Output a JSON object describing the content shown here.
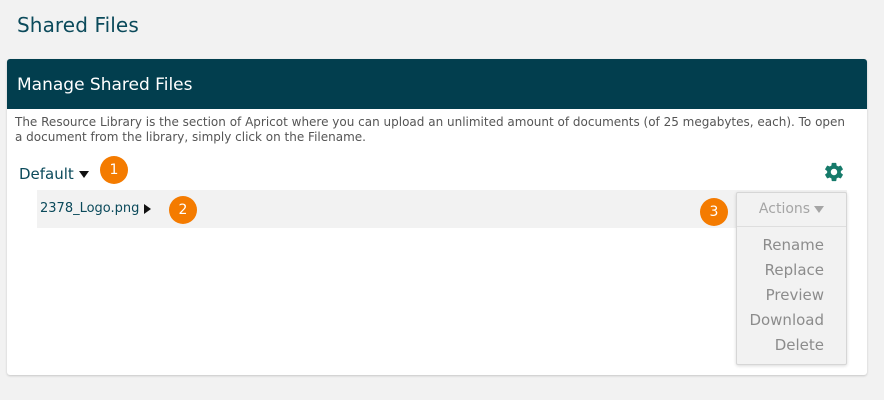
{
  "page": {
    "title": "Shared Files"
  },
  "panel": {
    "title": "Manage Shared Files",
    "description": "The Resource Library is the section of Apricot where you can upload an unlimited amount of documents (of 25 megabytes, each). To open a document from the library, simply click on the Filename."
  },
  "folder": {
    "selected": "Default"
  },
  "files": [
    {
      "name": "2378_Logo.png"
    }
  ],
  "actions": {
    "label": "Actions",
    "items": [
      "Rename",
      "Replace",
      "Preview",
      "Download",
      "Delete"
    ]
  },
  "callouts": [
    "1",
    "2",
    "3"
  ],
  "colors": {
    "header": "#023e4e",
    "accent": "#f47b00",
    "link": "#0b4a5b",
    "gear": "#167a6a"
  },
  "icons": {
    "settings": "gear-icon",
    "folder_toggle": "caret-down-icon",
    "file_toggle": "caret-right-icon"
  }
}
